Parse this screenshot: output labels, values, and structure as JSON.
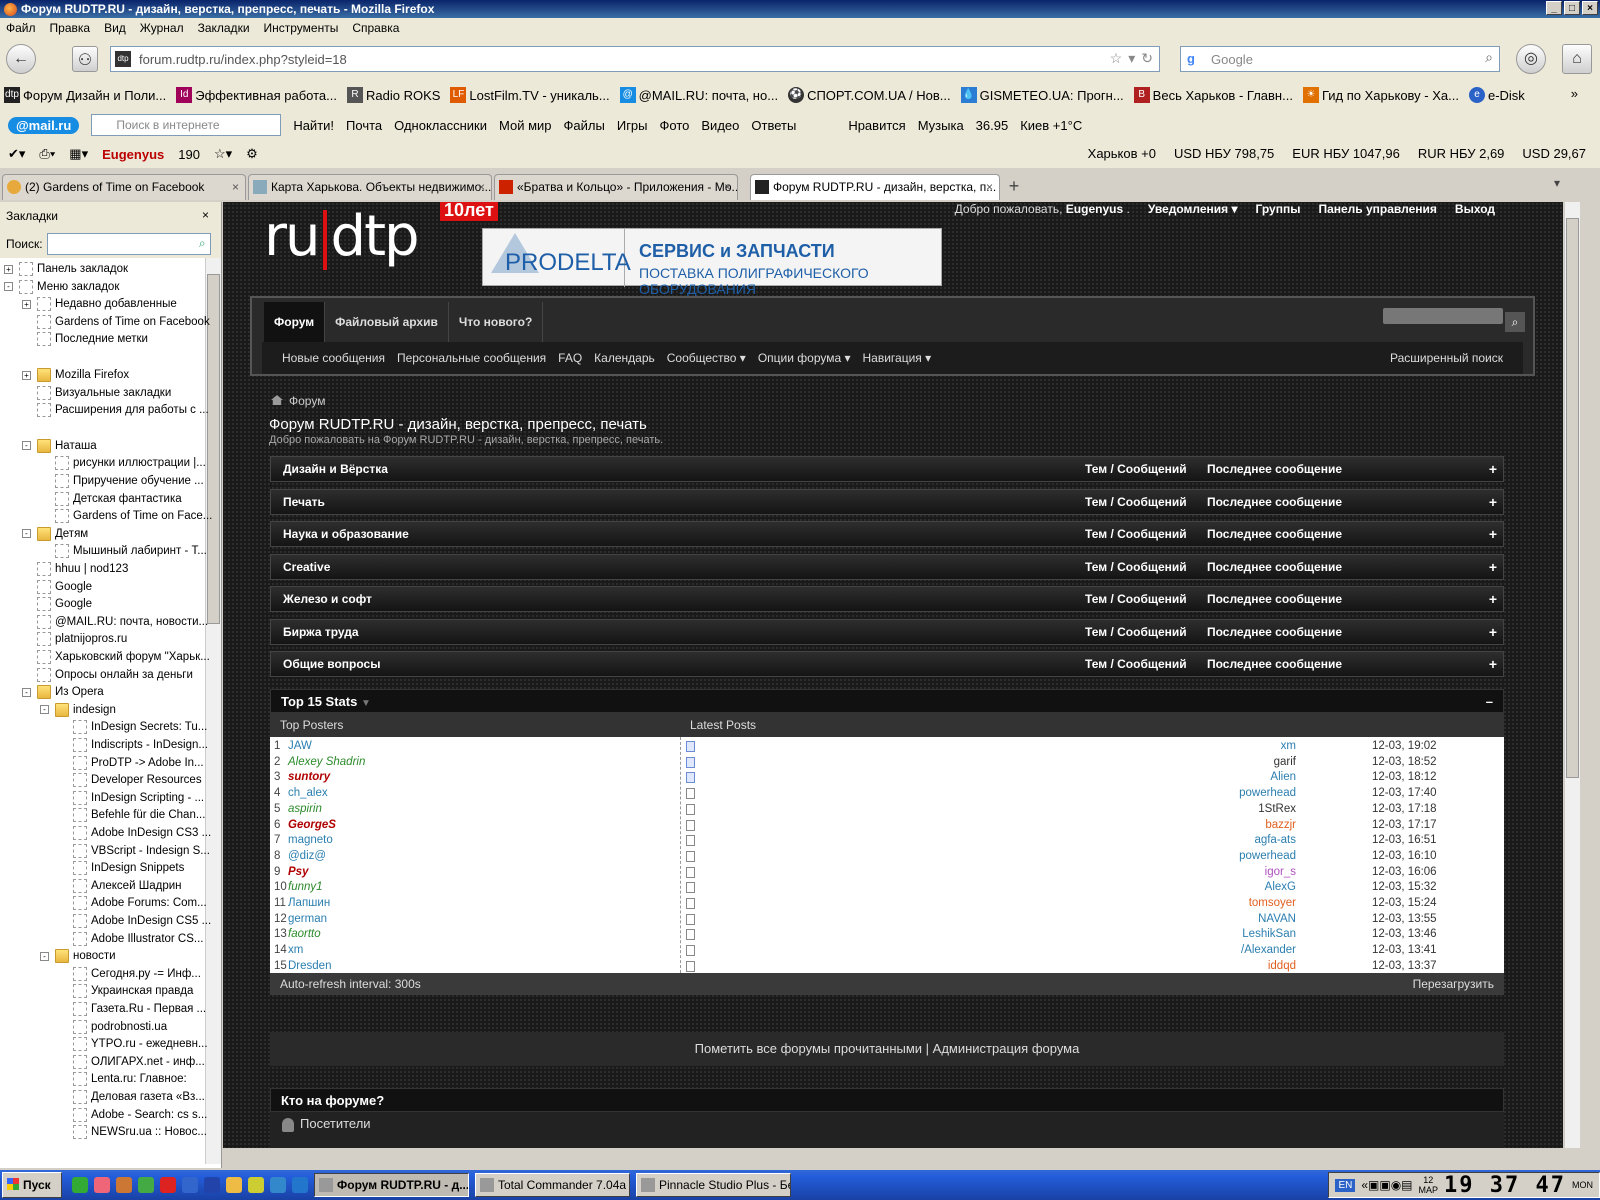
{
  "window": {
    "title": "Форум RUDTP.RU - дизайн, верстка, препресс, печать - Mozilla Firefox",
    "controls": [
      "_",
      "□",
      "×"
    ]
  },
  "menu": [
    "Файл",
    "Правка",
    "Вид",
    "Журнал",
    "Закладки",
    "Инструменты",
    "Справка"
  ],
  "nav": {
    "url": "forum.rudtp.ru/index.php?styleid=18",
    "search_placeholder": "Google"
  },
  "bookmarks_bar": [
    {
      "label": "Форум Дизайн и Поли...",
      "color": "#222222"
    },
    {
      "label": "Эффективная работа...",
      "color": "#a0005a"
    },
    {
      "label": "Radio ROKS",
      "color": "#555555"
    },
    {
      "label": "LostFilm.TV - уникаль...",
      "color": "#e05a00"
    },
    {
      "label": "@MAIL.RU: почта, но...",
      "color": "#168de2"
    },
    {
      "label": "СПОРТ.COM.UA / Нов...",
      "color": "#333333"
    },
    {
      "label": "GISMETEO.UA: Прогн...",
      "color": "#2b7cd3"
    },
    {
      "label": "Весь Харьков - Главн...",
      "color": "#b02020"
    },
    {
      "label": "Гид по Харькову - Ха...",
      "color": "#e07000"
    },
    {
      "label": "e-Disk",
      "color": "#2b62c7"
    }
  ],
  "bookmarks_more": "»",
  "mailbar": {
    "logo": "@mail.ru",
    "search_placeholder": "Поиск в интернете",
    "find_btn": "Найти!",
    "items": [
      "Почта",
      "Одноклассники",
      "Мой мир",
      "Файлы",
      "Игры",
      "Фото",
      "Видео",
      "Ответы",
      "Нравится",
      "Музыка",
      "36.95",
      "Киев +1°C"
    ]
  },
  "toolbar3": {
    "user": "Eugenyus",
    "mail_count": "190",
    "right": [
      "Харьков +0",
      "USD НБУ 798,75",
      "EUR НБУ 1047,96",
      "RUR НБУ 2,69",
      "USD 29,67"
    ]
  },
  "tabs": [
    {
      "label": "(2) Gardens of Time on Facebook",
      "active": false
    },
    {
      "label": "Карта Харькова. Объекты недвижимо...",
      "active": false
    },
    {
      "label": "«Братва и Кольцо» - Приложения - Мо...",
      "active": false
    },
    {
      "label": "Форум RUDTP.RU - дизайн, верстка, п...",
      "active": true
    }
  ],
  "sidebar": {
    "title": "Закладки",
    "search_label": "Поиск:",
    "items": [
      {
        "label": "Панель закладок",
        "indent": 0,
        "exp": "+",
        "icon": "page"
      },
      {
        "label": "Меню закладок",
        "indent": 0,
        "exp": "-",
        "icon": "page"
      },
      {
        "label": "Недавно добавленные",
        "indent": 1,
        "exp": "+",
        "icon": "page"
      },
      {
        "label": "Gardens of Time on Facebook",
        "indent": 1,
        "exp": "",
        "icon": "page"
      },
      {
        "label": "Последние метки",
        "indent": 1,
        "exp": "",
        "icon": "page"
      },
      {
        "label": "Mozilla Firefox",
        "indent": 1,
        "exp": "+",
        "icon": "folder"
      },
      {
        "label": "Визуальные закладки",
        "indent": 1,
        "exp": "",
        "icon": "page"
      },
      {
        "label": "Расширения для работы с ...",
        "indent": 1,
        "exp": "",
        "icon": "page"
      },
      {
        "label": "Наташа",
        "indent": 1,
        "exp": "-",
        "icon": "folder"
      },
      {
        "label": "рисунки иллюстрации |...",
        "indent": 2,
        "exp": "",
        "icon": "page"
      },
      {
        "label": "Приручение обучение ...",
        "indent": 2,
        "exp": "",
        "icon": "page"
      },
      {
        "label": "Детская фантастика",
        "indent": 2,
        "exp": "",
        "icon": "page"
      },
      {
        "label": "Gardens of Time on Face...",
        "indent": 2,
        "exp": "",
        "icon": "page"
      },
      {
        "label": "Детям",
        "indent": 1,
        "exp": "-",
        "icon": "folder"
      },
      {
        "label": "Мышиный лабиринт - Т...",
        "indent": 2,
        "exp": "",
        "icon": "page"
      },
      {
        "label": "hhuu | nod123",
        "indent": 1,
        "exp": "",
        "icon": "page"
      },
      {
        "label": "Google",
        "indent": 1,
        "exp": "",
        "icon": "page"
      },
      {
        "label": "Google",
        "indent": 1,
        "exp": "",
        "icon": "page"
      },
      {
        "label": "@MAIL.RU: почта, новости...",
        "indent": 1,
        "exp": "",
        "icon": "page"
      },
      {
        "label": "platnijopros.ru",
        "indent": 1,
        "exp": "",
        "icon": "page"
      },
      {
        "label": "Харьковский форум \"Харьк...",
        "indent": 1,
        "exp": "",
        "icon": "page"
      },
      {
        "label": "Опросы онлайн за деньги",
        "indent": 1,
        "exp": "",
        "icon": "page"
      },
      {
        "label": "Из Opera",
        "indent": 1,
        "exp": "-",
        "icon": "folder"
      },
      {
        "label": "indesign",
        "indent": 2,
        "exp": "-",
        "icon": "folder"
      },
      {
        "label": "InDesign Secrets: Tu...",
        "indent": 3,
        "exp": "",
        "icon": "page"
      },
      {
        "label": "Indiscripts - InDesign...",
        "indent": 3,
        "exp": "",
        "icon": "page"
      },
      {
        "label": "ProDTP -> Adobe In...",
        "indent": 3,
        "exp": "",
        "icon": "page"
      },
      {
        "label": "Developer Resources",
        "indent": 3,
        "exp": "",
        "icon": "page"
      },
      {
        "label": "InDesign Scripting - ...",
        "indent": 3,
        "exp": "",
        "icon": "page"
      },
      {
        "label": "Befehle für die Chan...",
        "indent": 3,
        "exp": "",
        "icon": "page"
      },
      {
        "label": "Adobe InDesign CS3 ...",
        "indent": 3,
        "exp": "",
        "icon": "page"
      },
      {
        "label": "VBScript - Indesign S...",
        "indent": 3,
        "exp": "",
        "icon": "page"
      },
      {
        "label": "InDesign Snippets",
        "indent": 3,
        "exp": "",
        "icon": "page"
      },
      {
        "label": "Алексей Шадрин",
        "indent": 3,
        "exp": "",
        "icon": "page"
      },
      {
        "label": "Adobe Forums: Com...",
        "indent": 3,
        "exp": "",
        "icon": "page"
      },
      {
        "label": "Adobe InDesign CS5 ...",
        "indent": 3,
        "exp": "",
        "icon": "page"
      },
      {
        "label": "Adobe Illustrator CS...",
        "indent": 3,
        "exp": "",
        "icon": "page"
      },
      {
        "label": "новости",
        "indent": 2,
        "exp": "-",
        "icon": "folder"
      },
      {
        "label": "Сегодня.ру -= Инф...",
        "indent": 3,
        "exp": "",
        "icon": "page"
      },
      {
        "label": "Украинская правда",
        "indent": 3,
        "exp": "",
        "icon": "page"
      },
      {
        "label": "Газета.Ru - Первая ...",
        "indent": 3,
        "exp": "",
        "icon": "page"
      },
      {
        "label": "podrobnosti.ua",
        "indent": 3,
        "exp": "",
        "icon": "page"
      },
      {
        "label": "YTPO.ru - ежедневн...",
        "indent": 3,
        "exp": "",
        "icon": "page"
      },
      {
        "label": "ОЛИГАРХ.net - инф...",
        "indent": 3,
        "exp": "",
        "icon": "page"
      },
      {
        "label": "Lenta.ru: Главное:",
        "indent": 3,
        "exp": "",
        "icon": "page"
      },
      {
        "label": "Деловая газета «Вз...",
        "indent": 3,
        "exp": "",
        "icon": "page"
      },
      {
        "label": "Adobe - Search: cs s...",
        "indent": 3,
        "exp": "",
        "icon": "page"
      },
      {
        "label": "NEWSru.ua :: Новос...",
        "indent": 3,
        "exp": "",
        "icon": "page"
      }
    ]
  },
  "site": {
    "logo_text_left": "ru",
    "logo_text_right": "dtp",
    "logo_badge": "10лет",
    "banner_brand": "PRODELTA",
    "banner_line1": "СЕРВИС и ЗАПЧАСТИ",
    "banner_line2": "ПОСТАВКА ПОЛИГРАФИЧЕСКОГО ОБОРУДОВАНИЯ",
    "welcome": "Добро пожаловать,",
    "username": "Eugenyus",
    "toplinks": [
      "Уведомления ▾",
      "Группы",
      "Панель управления",
      "Выход"
    ],
    "navtabs": [
      "Форум",
      "Файловый архив",
      "Что нового?"
    ],
    "subnav": [
      "Новые сообщения",
      "Персональные сообщения",
      "FAQ",
      "Календарь",
      "Сообщество ▾",
      "Опции форума ▾",
      "Навигация ▾"
    ],
    "advanced_search": "Расширенный поиск",
    "breadcrumb": "Форум",
    "title": "Форум RUDTP.RU - дизайн, верстка, препресс, печать",
    "subtitle": "Добро пожаловать на Форум RUDTP.RU - дизайн, верстка, препресс, печать.",
    "col_stats": "Тем / Сообщений",
    "col_last": "Последнее сообщение",
    "forums": [
      "Дизайн и Вёрстка",
      "Печать",
      "Наука и образование",
      "Creative",
      "Железо и софт",
      "Биржа труда",
      "Общие вопросы"
    ]
  },
  "stats": {
    "title": "Top 15 Stats",
    "col_posters": "Top Posters",
    "col_latest": "Latest Posts",
    "posters": [
      {
        "name": "JAW",
        "color": "#2b7fb0",
        "style": "normal"
      },
      {
        "name": "Alexey Shadrin",
        "color": "#2b8a2b",
        "style": "italic"
      },
      {
        "name": "suntory",
        "color": "#b00000",
        "style": "bolditalic"
      },
      {
        "name": "ch_alex",
        "color": "#2b7fb0",
        "style": "normal"
      },
      {
        "name": "aspirin",
        "color": "#2b8a2b",
        "style": "italic"
      },
      {
        "name": "GeorgeS",
        "color": "#b00000",
        "style": "bolditalic"
      },
      {
        "name": "magneto",
        "color": "#2b7fb0",
        "style": "normal"
      },
      {
        "name": "@diz@",
        "color": "#2b7fb0",
        "style": "normal"
      },
      {
        "name": "Psy",
        "color": "#b00000",
        "style": "bolditalic"
      },
      {
        "name": "funny1",
        "color": "#2b8a2b",
        "style": "italic"
      },
      {
        "name": "Лапшин",
        "color": "#2b7fb0",
        "style": "normal"
      },
      {
        "name": "german",
        "color": "#2b7fb0",
        "style": "normal"
      },
      {
        "name": "faortto",
        "color": "#2b8a2b",
        "style": "italic"
      },
      {
        "name": "xm",
        "color": "#2b7fb0",
        "style": "normal"
      },
      {
        "name": "Dresden",
        "color": "#2b7fb0",
        "style": "normal"
      }
    ],
    "latest": [
      {
        "user": "xm",
        "color": "#2b7fb0",
        "time": "12-03, 19:02",
        "new": true
      },
      {
        "user": "garif",
        "color": "#333333",
        "time": "12-03, 18:52",
        "new": true
      },
      {
        "user": "Alien",
        "color": "#2b7fb0",
        "time": "12-03, 18:12",
        "new": true
      },
      {
        "user": "powerhead",
        "color": "#2b7fb0",
        "time": "12-03, 17:40",
        "new": false
      },
      {
        "user": "1StRex",
        "color": "#333333",
        "time": "12-03, 17:18",
        "new": false
      },
      {
        "user": "bazzjr",
        "color": "#e06020",
        "time": "12-03, 17:17",
        "new": false
      },
      {
        "user": "agfa-ats",
        "color": "#2b7fb0",
        "time": "12-03, 16:51",
        "new": false
      },
      {
        "user": "powerhead",
        "color": "#2b7fb0",
        "time": "12-03, 16:10",
        "new": false
      },
      {
        "user": "igor_s",
        "color": "#b050c0",
        "time": "12-03, 16:06",
        "new": false
      },
      {
        "user": "AlexG",
        "color": "#2b7fb0",
        "time": "12-03, 15:32",
        "new": false
      },
      {
        "user": "tomsoyer",
        "color": "#e06020",
        "time": "12-03, 15:24",
        "new": false
      },
      {
        "user": "NAVAN",
        "color": "#2b7fb0",
        "time": "12-03, 13:55",
        "new": false
      },
      {
        "user": "LeshikSan",
        "color": "#2b7fb0",
        "time": "12-03, 13:46",
        "new": false
      },
      {
        "user": "/Alexander",
        "color": "#2b7fb0",
        "time": "12-03, 13:41",
        "new": false
      },
      {
        "user": "iddqd",
        "color": "#e06020",
        "time": "12-03, 13:37",
        "new": false
      }
    ],
    "footer_interval": "Auto-refresh interval: 300s",
    "footer_reload": "Перезагрузить"
  },
  "footer_links": "Пометить все форумы прочитанными | Администрация форума",
  "whos_online": {
    "title": "Кто на форуме?",
    "visitors": "Посетители"
  },
  "taskbar": {
    "start": "Пуск",
    "tasks": [
      {
        "label": "Форум RUDTP.RU - д...",
        "active": true
      },
      {
        "label": "Total Commander 7.04a ...",
        "active": false
      },
      {
        "label": "Pinnacle Studio Plus - Бе...",
        "active": false
      }
    ],
    "lang": "EN",
    "date_day": "12",
    "date_month": "МАР",
    "clock": "19 37 47",
    "weekday": "MON"
  }
}
